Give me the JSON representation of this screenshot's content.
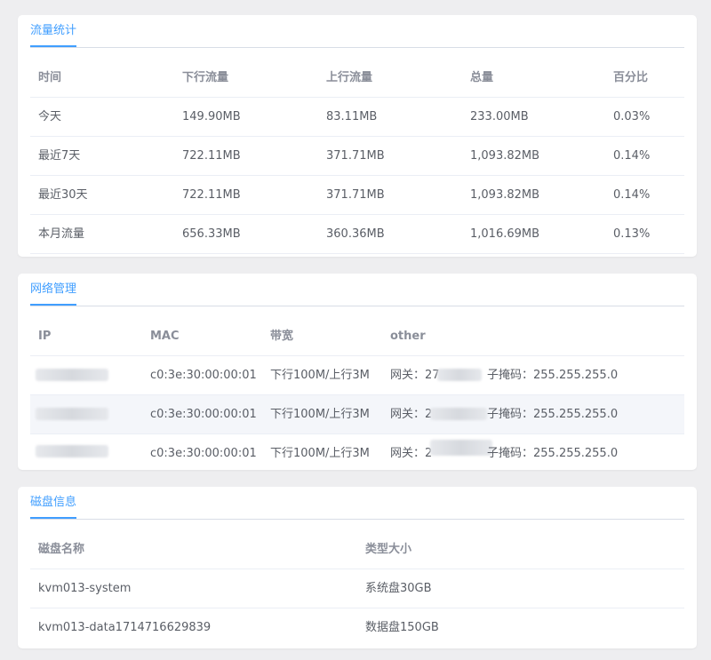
{
  "traffic": {
    "title": "流量统计",
    "headers": [
      "时间",
      "下行流量",
      "上行流量",
      "总量",
      "百分比"
    ],
    "rows": [
      [
        "今天",
        "149.90MB",
        "83.11MB",
        "233.00MB",
        "0.03%"
      ],
      [
        "最近7天",
        "722.11MB",
        "371.71MB",
        "1,093.82MB",
        "0.14%"
      ],
      [
        "最近30天",
        "722.11MB",
        "371.71MB",
        "1,093.82MB",
        "0.14%"
      ],
      [
        "本月流量",
        "656.33MB",
        "360.36MB",
        "1,016.69MB",
        "0.13%"
      ]
    ]
  },
  "network": {
    "title": "网络管理",
    "headers": [
      "IP",
      "MAC",
      "带宽",
      "other"
    ],
    "rows": [
      {
        "mac": "c0:3e:30:00:00:01",
        "bandwidth": "下行100M/上行3M",
        "gateway_prefix": "网关：27",
        "mask": "子掩码：255.255.255.0"
      },
      {
        "mac": "c0:3e:30:00:00:01",
        "bandwidth": "下行100M/上行3M",
        "gateway_prefix": "网关：2",
        "mask": "子掩码：255.255.255.0"
      },
      {
        "mac": "c0:3e:30:00:00:01",
        "bandwidth": "下行100M/上行3M",
        "gateway_prefix": "网关：2",
        "mask": "子掩码：255.255.255.0"
      }
    ]
  },
  "disk": {
    "title": "磁盘信息",
    "headers": [
      "磁盘名称",
      "类型大小"
    ],
    "rows": [
      [
        "kvm013-system",
        "系统盘30GB"
      ],
      [
        "kvm013-data1714716629839",
        "数据盘150GB"
      ]
    ]
  },
  "colors": {
    "accent": "#409eff",
    "background": "#eeeef0"
  }
}
